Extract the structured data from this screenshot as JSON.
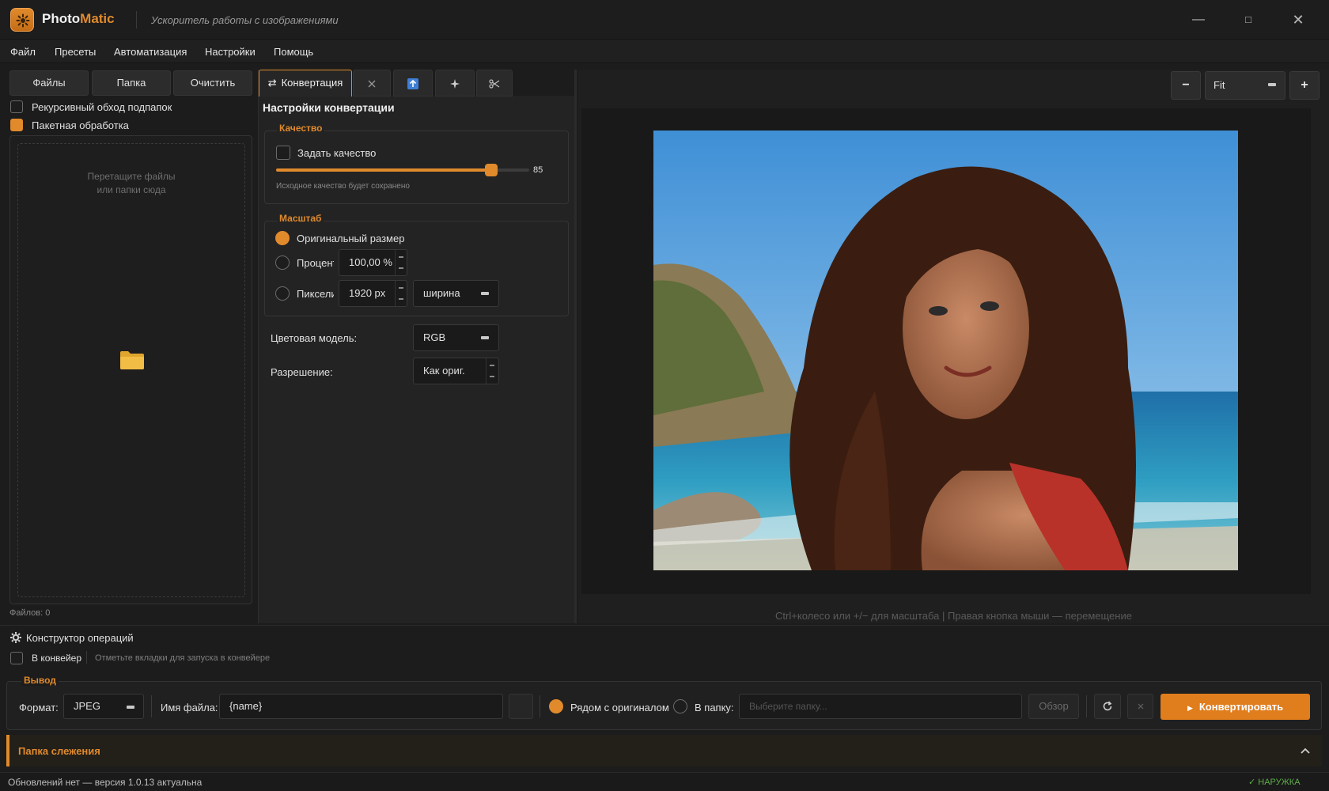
{
  "app": {
    "name_part1": "Photo",
    "name_part2": "Matic",
    "subtitle": "Ускоритель работы с изображениями",
    "window_controls": {
      "minimize": "—",
      "maximize": "□",
      "close": "✕"
    }
  },
  "menu": [
    "Файл",
    "Пресеты",
    "Автоматизация",
    "Настройки",
    "Помощь"
  ],
  "left": {
    "buttons": {
      "files": "Файлы",
      "folder": "Папка",
      "clear": "Очистить"
    },
    "recursive_label": "Рекурсивный обход подпапок",
    "recursive_checked": false,
    "batch_label": "Пакетная обработка",
    "batch_checked": true,
    "drop_hint_line1": "Перетащите файлы",
    "drop_hint_line2": "или папки сюда",
    "files_count": "Файлов: 0"
  },
  "tabs": {
    "convert": "Конвертация",
    "convert_icon": "⇄",
    "icons": [
      "close-icon",
      "upload-icon",
      "sparkle-icon",
      "scissors-icon"
    ]
  },
  "convert_settings": {
    "title": "Настройки конвертации",
    "quality": {
      "group_title": "Качество",
      "set_quality_label": "Задать качество",
      "set_quality_checked": false,
      "slider_value": 85,
      "slider_value_text": "85",
      "slider_min": 0,
      "slider_max": 100,
      "note": "Исходное качество будет сохранено"
    },
    "scale": {
      "group_title": "Масштаб",
      "original_label": "Оригинальный размер",
      "percent_label": "Процент",
      "percent_value": "100,00 %",
      "pixels_label": "Пиксели",
      "pixels_value": "1920 px",
      "dimension_value": "ширина",
      "selected": "original"
    },
    "color_model_label": "Цветовая модель:",
    "color_model_value": "RGB",
    "resolution_label": "Разрешение:",
    "resolution_value": "Как ориг."
  },
  "preview": {
    "zoom_out": "−",
    "zoom_value": "Fit",
    "zoom_in": "+",
    "hint": "Ctrl+колесо или +/− для масштаба  |  Правая кнопка мыши — перемещение"
  },
  "pipeline": {
    "constructor_label": "Конструктор операций",
    "pipeline_label": "В конвейер",
    "pipeline_checked": false,
    "pipeline_hint": "Отметьте вкладки для запуска в конвейере"
  },
  "output": {
    "group_title": "Вывод",
    "format_label": "Формат:",
    "format_value": "JPEG",
    "filename_label": "Имя файла:",
    "filename_value": "{name}",
    "beside_original_label": "Рядом с оригиналом",
    "beside_original_selected": true,
    "to_folder_label": "В папку:",
    "folder_placeholder": "Выберите папку...",
    "browse_label": "Обзор",
    "convert_label": "Конвертировать"
  },
  "watch_folder": {
    "title": "Папка слежения"
  },
  "status": {
    "left": "Обновлений нет — версия 1.0.13 актуальна",
    "right": "✓ НАРУЖКА"
  },
  "colors": {
    "accent": "#e08a2c",
    "bg": "#1c1c1c",
    "status_ok": "#5fae4a"
  }
}
